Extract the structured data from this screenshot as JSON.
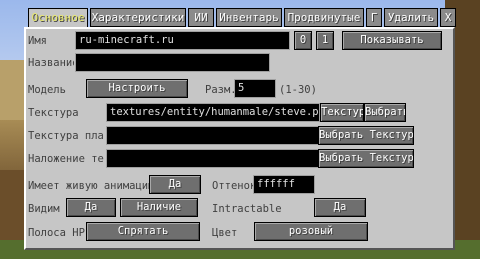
{
  "tabs": [
    {
      "label": "Основное"
    },
    {
      "label": "Характеристики"
    },
    {
      "label": "ИИ"
    },
    {
      "label": "Инвентарь"
    },
    {
      "label": "Продвинутые"
    },
    {
      "label": "Г"
    },
    {
      "label": "Удалить"
    },
    {
      "label": "Х"
    }
  ],
  "fields": {
    "name_label": "Имя",
    "name_value": "ru-minecraft.ru",
    "name_small_btn1": "0",
    "name_small_btn2": "1",
    "show_button": "Показывать",
    "title_label": "Название",
    "title_value": "",
    "model_label": "Модель",
    "configure_button": "Настроить",
    "size_label": "Разм.",
    "size_value": "5",
    "size_range": "(1-30)",
    "texture_label": "Текстура",
    "texture_value": "textures/entity/humanmale/steve.png",
    "texture_btn1": "Текстура",
    "texture_btn2": "Выбрать",
    "cape_label": "Текстура плаш",
    "cape_value": "",
    "cape_button": "Выбрать Текстуру",
    "overlay_label": "Наложение тек",
    "overlay_value": "",
    "overlay_button": "Выбрать Текстуру",
    "living_anim_label": "Имеет живую анимацию",
    "living_anim_button": "Да",
    "tint_label": "Оттенок",
    "tint_value": "ffffff",
    "visible_label": "Видим",
    "visible_button": "Да",
    "presence_button": "Наличие",
    "interactable_label": "Intractable",
    "interactable_button": "Да",
    "hp_bar_label": "Полоса HP",
    "hp_bar_button": "Спрятать",
    "color_label": "Цвет",
    "color_button": "розовый"
  }
}
